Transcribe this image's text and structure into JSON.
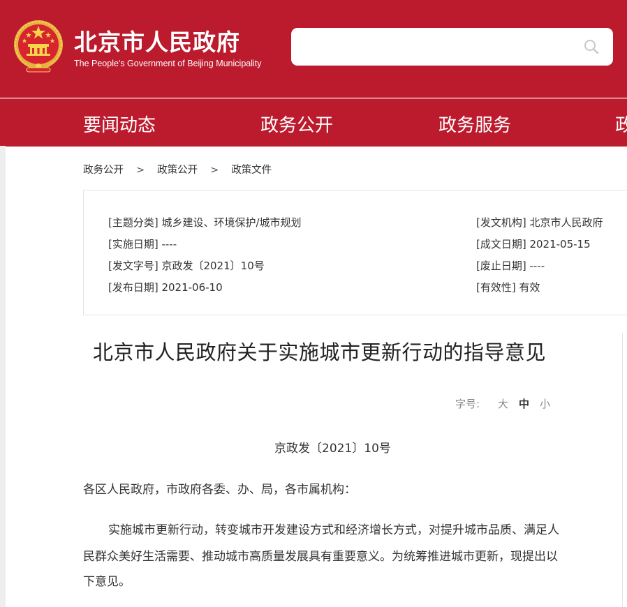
{
  "header": {
    "site_name": "北京市人民政府",
    "site_name_en": "The People's Government of Beijing Municipality",
    "search_placeholder": "",
    "brand_color": "#bc1a2d"
  },
  "nav": {
    "items": [
      {
        "label": "要闻动态"
      },
      {
        "label": "政务公开"
      },
      {
        "label": "政务服务"
      },
      {
        "label": "政"
      }
    ]
  },
  "breadcrumb": {
    "items": [
      "政务公开",
      "政策公开",
      "政策文件"
    ],
    "separator": ">"
  },
  "meta": {
    "topic": "[主题分类] 城乡建设、环境保护/城市规划",
    "effective_date": "[实施日期] ----",
    "doc_number": "[发文字号] 京政发〔2021〕10号",
    "publish_date": "[发布日期] 2021-06-10",
    "issuer": "[发文机构] 北京市人民政府",
    "written_date": "[成文日期] 2021-05-15",
    "repeal_date": "[废止日期] ----",
    "validity": "[有效性] 有效"
  },
  "article": {
    "title": "北京市人民政府关于实施城市更新行动的指导意见",
    "font_size_label": "字号:",
    "font_size_options": [
      "大",
      "中",
      "小"
    ],
    "doc_no": "京政发〔2021〕10号",
    "addressee": "各区人民政府，市政府各委、办、局，各市属机构：",
    "para1_lines": [
      "实施城市更新行动，转变城市开发建设方式和经济增长方式，对提升城市品质、满足人",
      "民群众美好生活需要、推动城市高质量发展具有重要意义。为统筹推进城市更新，现提出以",
      "下意见。"
    ]
  },
  "icons": {
    "emblem": "national-emblem-icon",
    "search": "search-icon"
  }
}
